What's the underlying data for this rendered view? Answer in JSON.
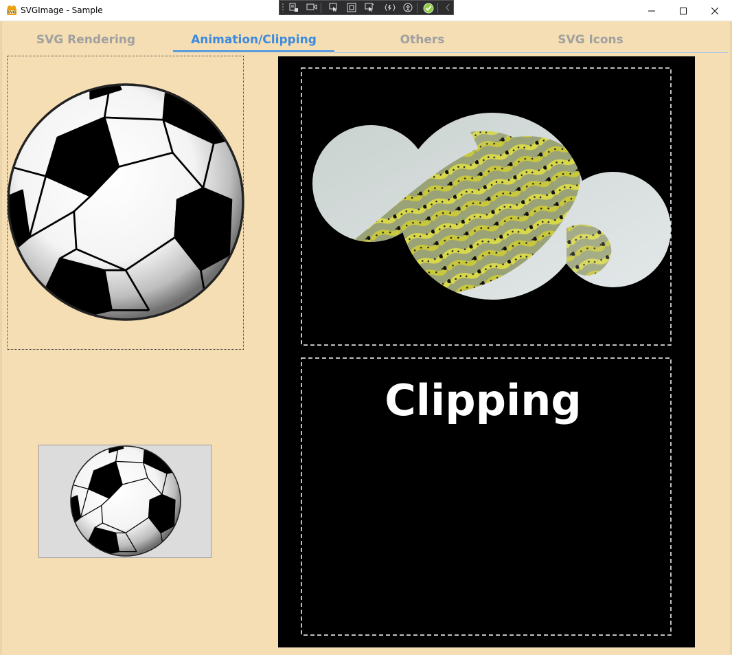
{
  "window": {
    "title": "SVGImage - Sample",
    "controls": {
      "minimize": "minimize-icon",
      "maximize": "maximize-icon",
      "close": "close-icon"
    }
  },
  "devtools": {
    "buttons": [
      "live-visual-tree-icon",
      "record-icon",
      "select-element-icon",
      "display-layout-icon",
      "track-focus-icon",
      "hot-reload-icon",
      "accessibility-icon",
      "binding-ok-icon",
      "collapse-icon"
    ]
  },
  "tabs": [
    {
      "label": "SVG Rendering",
      "active": false
    },
    {
      "label": "Animation/Clipping",
      "active": true
    },
    {
      "label": "Others",
      "active": false
    },
    {
      "label": "SVG Icons",
      "active": false
    }
  ],
  "clipping": {
    "text": "Clipping"
  },
  "colors": {
    "background": "#f5deb3",
    "active_tab": "#3c8ae0",
    "inactive_tab": "#a0a0a0",
    "panel": "#000000"
  }
}
